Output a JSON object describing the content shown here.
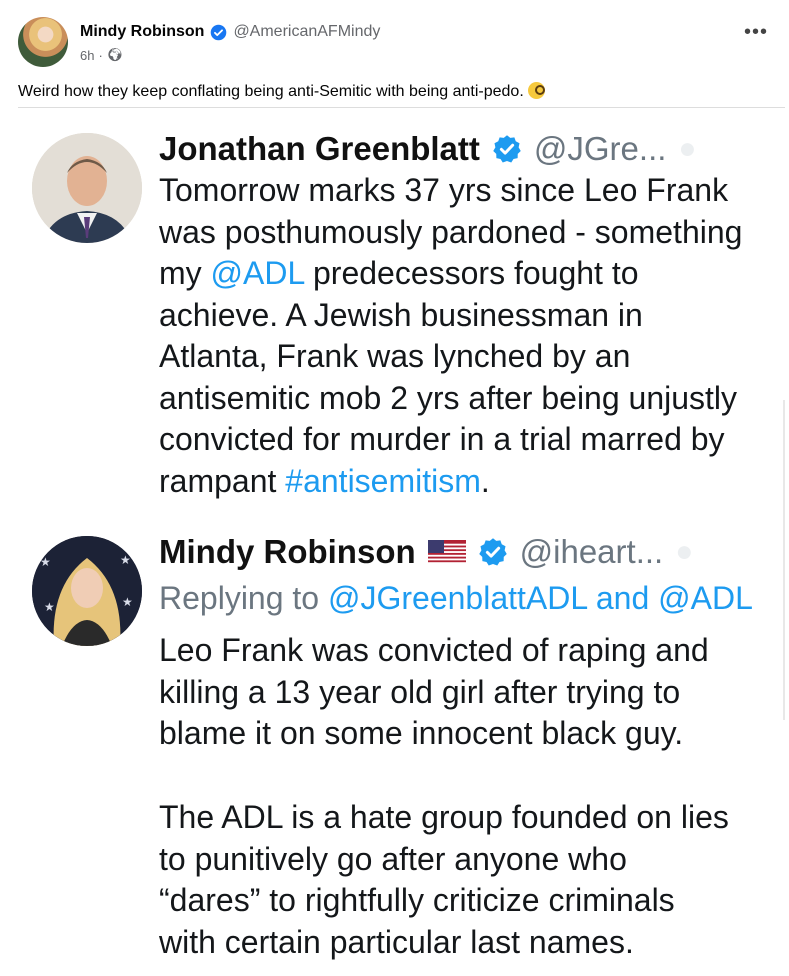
{
  "post": {
    "author": "Mindy Robinson",
    "handle": "@AmericanAFMindy",
    "time": "6h",
    "separator": "·",
    "caption": "Weird how they keep conflating being anti-Semitic with being anti-pedo."
  },
  "tweet1": {
    "name": "Jonathan Greenblatt",
    "handle": "@JGre...",
    "lines": [
      [
        "Tomorrow marks 37 yrs since Leo Frank"
      ],
      [
        "was posthumously pardoned - something"
      ],
      [
        "my ",
        "@ADL",
        " predecessors fought to"
      ],
      [
        "achieve. A Jewish businessman in"
      ],
      [
        "Atlanta, Frank was lynched by an"
      ],
      [
        "antisemitic mob 2 yrs after being unjustly"
      ],
      [
        "convicted for murder in a trial marred by"
      ],
      [
        "rampant ",
        "#antisemitism",
        "."
      ]
    ]
  },
  "tweet2": {
    "name": "Mindy Robinson",
    "handle": "@iheart...",
    "replying_prefix": "Replying to ",
    "replying_to": "@JGreenblattADL and @ADL",
    "para1": [
      "Leo Frank was convicted of raping and",
      "killing a 13 year old girl after trying to",
      "blame it on some innocent black guy."
    ],
    "para2": [
      "The ADL is a hate group founded on lies",
      "to punitively go after anyone who",
      "“dares” to rightfully criticize criminals",
      "with certain particular last names."
    ]
  },
  "icons": {
    "verified": "verified-badge-icon",
    "globe": "globe-icon",
    "more": "more-options-icon",
    "flag": "us-flag-icon",
    "emoji": "monocle-face-emoji"
  },
  "colors": {
    "link": "#1d9bf0",
    "verified": "#1d9bf0",
    "meta": "#65676b"
  }
}
